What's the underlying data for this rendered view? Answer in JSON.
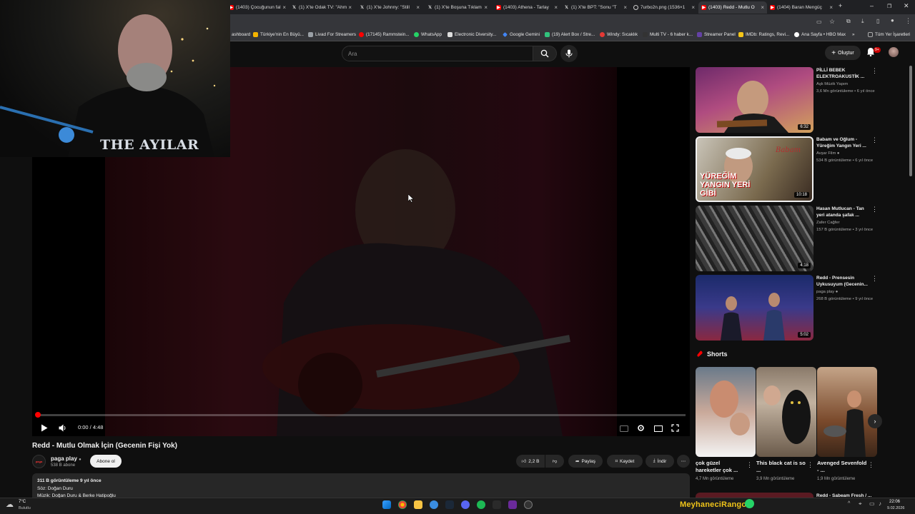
{
  "browser": {
    "tabs": [
      {
        "title": "(1403) Çocuğunun fal",
        "icon": "youtube-icon"
      },
      {
        "title": "(1) X'te Odak TV: \"Ahm",
        "icon": "x-icon"
      },
      {
        "title": "(1) X'te Johnny: \"Still",
        "icon": "x-icon"
      },
      {
        "title": "(1) X'te Boşuna Tıklam",
        "icon": "x-icon"
      },
      {
        "title": "(1403) Athena - Tarlay",
        "icon": "youtube-icon"
      },
      {
        "title": "(1) X'te BPT: \"Sonu \"T",
        "icon": "x-icon"
      },
      {
        "title": "7urbo2n.png (1536×1",
        "icon": "globe-icon"
      },
      {
        "title": "(1403) Redd - Mutlu O",
        "icon": "youtube-icon",
        "active": true
      },
      {
        "title": "(1404) Baran Mengüç",
        "icon": "youtube-icon"
      }
    ],
    "bookmarks": [
      {
        "label": "ashboard",
        "color": "#555555"
      },
      {
        "label": "Türkiye'nin En Büyü...",
        "color": "#f4b400"
      },
      {
        "label": "Livad For Streamers",
        "color": "#9aa0a6"
      },
      {
        "label": "(17145) Rammstein...",
        "color": "#ff0000"
      },
      {
        "label": "WhatsApp",
        "color": "#25d366"
      },
      {
        "label": "Electronic Diversity...",
        "color": "#dddddd"
      },
      {
        "label": "Google Gemini",
        "color": "#4285f4"
      },
      {
        "label": "(19) Alert Box / Stre...",
        "color": "#31c27c"
      },
      {
        "label": "Windy: Sıcaklık",
        "color": "#e53935"
      },
      {
        "label": "Multi TV - 6 haber k...",
        "color": "#333333"
      },
      {
        "label": "Streamer Panel",
        "color": "#6441a5"
      },
      {
        "label": "IMDb: Ratings, Revi...",
        "color": "#f5c518"
      },
      {
        "label": "Ana Sayfa • HBO Max",
        "color": "#ffffff"
      },
      {
        "label": "Tüm Yer İşaretleri",
        "color": "#aaaaaa"
      }
    ]
  },
  "header": {
    "search_placeholder": "Ara",
    "create_label": "Oluştur",
    "notif_count": "9+"
  },
  "webcam": {
    "shirt_text": "THE AYILAR"
  },
  "player": {
    "time": "0:00 / 4:48",
    "progress_fraction": 0.0
  },
  "video": {
    "title": "Redd - Mutlu Olmak İçin (Gecenin Fişi Yok)",
    "channel": "paga play",
    "channel_logo_text": "paga",
    "subscribers": "538 B abone",
    "subscribe_label": "Abone ol",
    "likes": "2,2 B",
    "share_label": "Paylaş",
    "save_label": "Kaydet",
    "download_label": "İndir",
    "views_date": "311 B görüntüleme  9 yıl önce",
    "lyrics": "Söz: Doğan Duru",
    "music": "Müzik: Doğan Duru & Berke Hatipoğlu"
  },
  "recommendations": [
    {
      "title": "PİLLİ BEBEK ELEKTROAKUSTİK ...",
      "channel": "Aşk Müzik Yapım",
      "meta": "3,6 Mn görüntüleme • 6 yıl önce",
      "duration": "6:32",
      "verified": false
    },
    {
      "title": "Babam ve Oğlum - Yüreğim Yangın Yeri ...",
      "channel": "Avşar Film",
      "meta": "534 B görüntüleme • 6 yıl önce",
      "duration": "10:18",
      "verified": true,
      "thumb_text": "YÜREĞİM YANGIN YERİ GİBİ"
    },
    {
      "title": "Hasan Mutlucan - Tan yeri atanda şafak ...",
      "channel": "Zafer Cağfer",
      "meta": "157 B görüntüleme • 3 yıl önce",
      "duration": "4:18",
      "verified": false
    },
    {
      "title": "Redd - Prensesin Uykusuyum (Gecenin...",
      "channel": "paga play",
      "meta": "268 B görüntüleme • 9 yıl önce",
      "duration": "5:02",
      "verified": true
    }
  ],
  "shorts": {
    "heading": "Shorts",
    "items": [
      {
        "title": "çok güzel hareketler çok ...",
        "views": "4,7 Mn görüntüleme"
      },
      {
        "title": "This black cat is so ...",
        "views": "3,9 Mn görüntüleme"
      },
      {
        "title": "Avenged Sevenfold - ...",
        "views": "1,9 Mn görüntüleme"
      }
    ],
    "partial_title": "Redd - Sabeam Fresh / ..."
  },
  "taskbar": {
    "temperature": "7°C",
    "weather": "Bulutlu",
    "streamer_name": "MeyhaneciRango",
    "time": "22:06",
    "date": "9.02.2026"
  },
  "colors": {
    "accent_red": "#ff0000",
    "yt_bg": "#0f0f0f",
    "streamer_gold": "#f0c419"
  }
}
